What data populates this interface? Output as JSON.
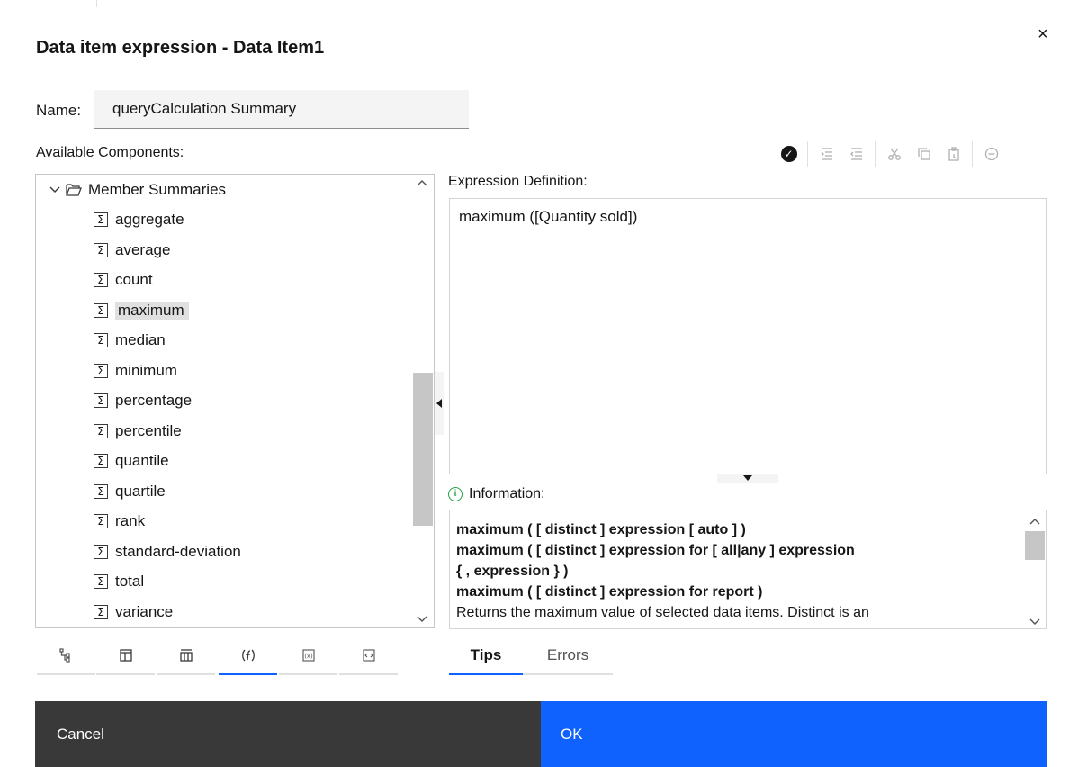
{
  "dialog": {
    "title": "Data item expression - Data Item1",
    "close_glyph": "×"
  },
  "name": {
    "label": "Name:",
    "value": "queryCalculation Summary"
  },
  "components": {
    "label": "Available Components:",
    "folder": "Member Summaries",
    "items": [
      "aggregate",
      "average",
      "count",
      "maximum",
      "median",
      "minimum",
      "percentage",
      "percentile",
      "quantile",
      "quartile",
      "rank",
      "standard-deviation",
      "total",
      "variance"
    ],
    "selected": "maximum",
    "item_icon": "Σ"
  },
  "toolbar": {
    "icons": [
      "validate-icon",
      "indent-icon",
      "outdent-icon",
      "cut-icon",
      "copy-icon",
      "paste-icon",
      "remove-icon"
    ]
  },
  "expression": {
    "label": "Expression Definition:",
    "value": "maximum ([Quantity sold])"
  },
  "information": {
    "label": "Information:",
    "lines": [
      "maximum ( [ distinct ] expression [ auto ] )",
      "maximum ( [ distinct ] expression for [ all|any ] expression",
      "{ , expression } )",
      "maximum ( [ distinct ] expression for report )",
      "Returns the maximum value of selected data items. Distinct is an"
    ]
  },
  "bottom_left_tabs": {
    "icons": [
      "source-tree-icon",
      "data-items-icon",
      "query-icon",
      "functions-icon",
      "parameters-icon",
      "macros-icon"
    ],
    "active": "functions-icon"
  },
  "bottom_right_tabs": {
    "tips": "Tips",
    "errors": "Errors",
    "active": "Tips"
  },
  "buttons": {
    "cancel": "Cancel",
    "ok": "OK"
  },
  "colors": {
    "primary": "#0f62fe",
    "secondary": "#393939",
    "info": "#24a148"
  }
}
